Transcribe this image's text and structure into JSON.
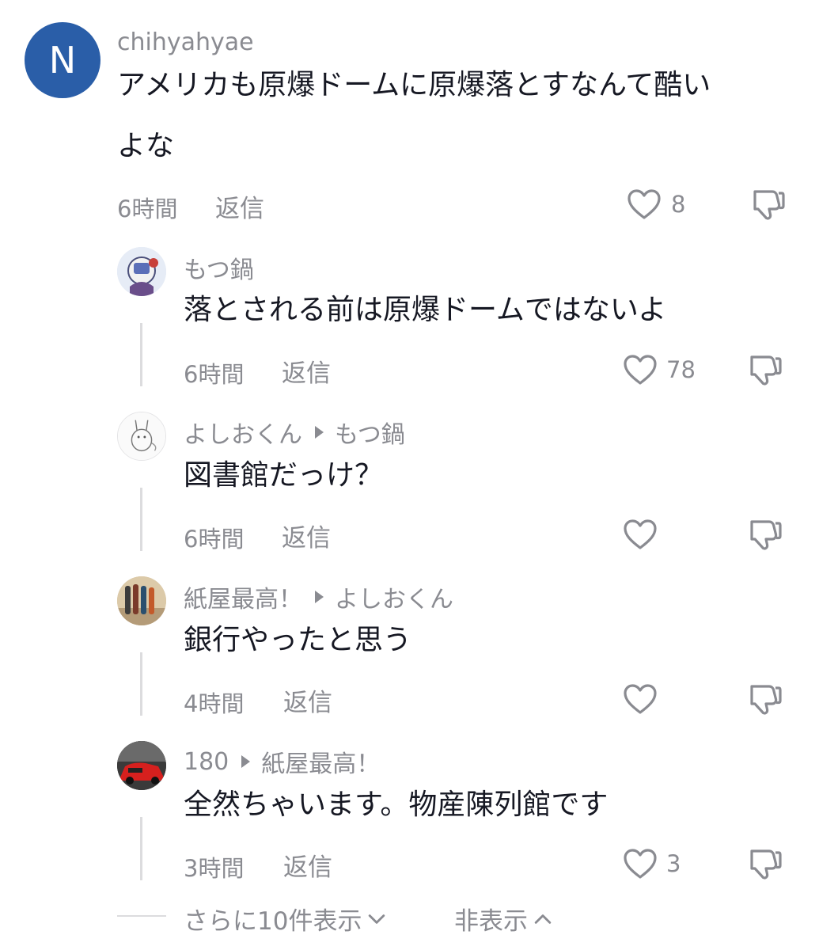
{
  "main_comment": {
    "avatar_letter": "N",
    "username": "chihyahyae",
    "text_line1": "アメリカも原爆ドームに原爆落とすなんて酷い",
    "text_line2": "よな",
    "time": "6時間",
    "reply_label": "返信",
    "likes": "8"
  },
  "replies": [
    {
      "username": "もつ鍋",
      "reply_to": "",
      "text": "落とされる前は原爆ドームではないよ",
      "time": "6時間",
      "reply_label": "返信",
      "likes": "78"
    },
    {
      "username": "よしおくん",
      "reply_to": "もつ鍋",
      "text": "図書館だっけ？",
      "time": "6時間",
      "reply_label": "返信",
      "likes": ""
    },
    {
      "username": "紙屋最高！",
      "reply_to": "よしおくん",
      "text": "銀行やったと思う",
      "time": "4時間",
      "reply_label": "返信",
      "likes": ""
    },
    {
      "username": "180",
      "reply_to": "紙屋最高！",
      "text": "全然ちゃいます。物産陳列館です",
      "time": "3時間",
      "reply_label": "返信",
      "likes": "3"
    }
  ],
  "footer": {
    "show_more": "さらに10件表示",
    "hide": "非表示"
  }
}
